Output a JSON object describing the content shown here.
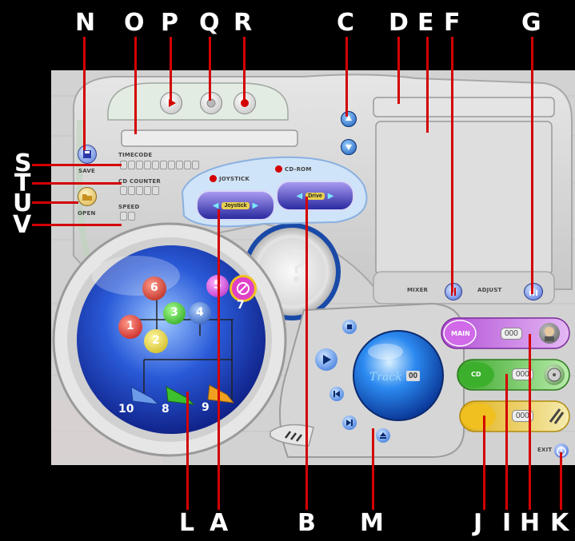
{
  "callouts": {
    "N": "N",
    "O": "O",
    "P": "P",
    "Q": "Q",
    "R": "R",
    "C": "C",
    "D": "D",
    "E": "E",
    "F": "F",
    "G": "G",
    "S": "S",
    "T": "T",
    "U": "U",
    "V": "V",
    "L": "L",
    "A": "A",
    "B": "B",
    "M": "M",
    "J": "J",
    "I": "I",
    "H": "H",
    "K": "K"
  },
  "labels": {
    "save": "SAVE",
    "open": "OPEN",
    "timecode": "TIMECODE",
    "cd_counter": "CD COUNTER",
    "speed": "SPEED",
    "joystick": "JOYSTICK",
    "cdrom": "CD-ROM",
    "mixer": "MIXER",
    "adjust": "ADJUST",
    "exit": "EXIT",
    "main": "MAIN",
    "cd": "CD",
    "track": "Track"
  },
  "selector_values": {
    "joystick": "Joystick",
    "cdrom": "Drive"
  },
  "track_number": "00",
  "display_digits": "000",
  "sphere_numbers": [
    "6",
    "5",
    "7",
    "3",
    "4",
    "1",
    "2",
    "10",
    "8",
    "9"
  ],
  "colors": {
    "accent": "#d40000",
    "main_pill": "#c06ad8",
    "cd_pill": "#56c03c",
    "third_pill": "#e8c020",
    "sphere": "#2a5ad8"
  }
}
